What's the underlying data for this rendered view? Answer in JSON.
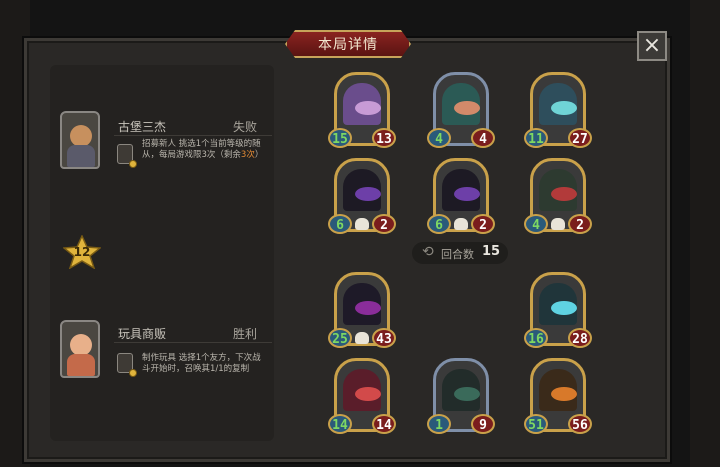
{
  "title": "本局详情",
  "close_label": "×",
  "players": [
    {
      "name": "古堡三杰",
      "result": "失败",
      "icon": "castle-trio-portrait-icon",
      "desc_pre": "招募新人 挑选1个当前等级的随从，每局游戏限3次（剩余",
      "desc_hl": "3次",
      "desc_post": "）"
    },
    {
      "name": "玩具商贩",
      "result": "胜利",
      "icon": "toy-merchant-portrait-icon",
      "desc_pre": "制作玩具 选择1个友方，下次战斗开始时，召唤其1/1的复制",
      "desc_hl": "",
      "desc_post": ""
    }
  ],
  "tier": "12",
  "turn": {
    "label": "回合数",
    "value": "15",
    "icon": "repeat-icon"
  },
  "minions": [
    {
      "atk": "15",
      "hp": "13",
      "frame": "gold",
      "icon": "pirate-woman-minion-icon",
      "c1": "#6a4d8c",
      "c2": "#c89bd6"
    },
    {
      "atk": "4",
      "hp": "4",
      "frame": "blue",
      "icon": "dryad-minion-icon",
      "c1": "#2b5a55",
      "c2": "#d28a6a"
    },
    {
      "atk": "11",
      "hp": "27",
      "frame": "gold",
      "icon": "ghost-knight-minion-icon",
      "c1": "#2e4e5c",
      "c2": "#6fd4d6"
    },
    {
      "atk": "6",
      "hp": "2",
      "frame": "gold",
      "icon": "hooded-reaper-minion-icon",
      "c1": "#1d1a24",
      "c2": "#6d3fa8",
      "skull": true
    },
    {
      "atk": "6",
      "hp": "2",
      "frame": "gold",
      "icon": "hooded-reaper-minion-icon",
      "c1": "#1d1a24",
      "c2": "#6d3fa8",
      "skull": true
    },
    {
      "atk": "4",
      "hp": "2",
      "frame": "gold",
      "icon": "goblin-beast-minion-icon",
      "c1": "#2d3a30",
      "c2": "#b23a3a",
      "skull": true
    },
    {
      "atk": "25",
      "hp": "43",
      "frame": "gold",
      "icon": "dark-lord-minion-icon",
      "c1": "#1e1a28",
      "c2": "#8a2d9a",
      "skull": true
    },
    {
      "atk": "16",
      "hp": "28",
      "frame": "gold",
      "icon": "blue-slime-ghost-minion-icon",
      "c1": "#20353a",
      "c2": "#5fd3e2"
    },
    {
      "atk": "14",
      "hp": "14",
      "frame": "gold",
      "icon": "jester-minion-icon",
      "c1": "#5a1d2a",
      "c2": "#d24a4a"
    },
    {
      "atk": "1",
      "hp": "9",
      "frame": "blue",
      "icon": "shadow-wraith-minion-icon",
      "c1": "#222c2a",
      "c2": "#3a6a5a"
    },
    {
      "atk": "51",
      "hp": "56",
      "frame": "gold",
      "icon": "pumpkin-golem-minion-icon",
      "c1": "#3a2a1a",
      "c2": "#d8792a"
    }
  ],
  "colors": {
    "panel": "#2a2826",
    "accent_red": "#8a2320",
    "gold": "#c9a14a",
    "attack_green": "#7ed862"
  }
}
